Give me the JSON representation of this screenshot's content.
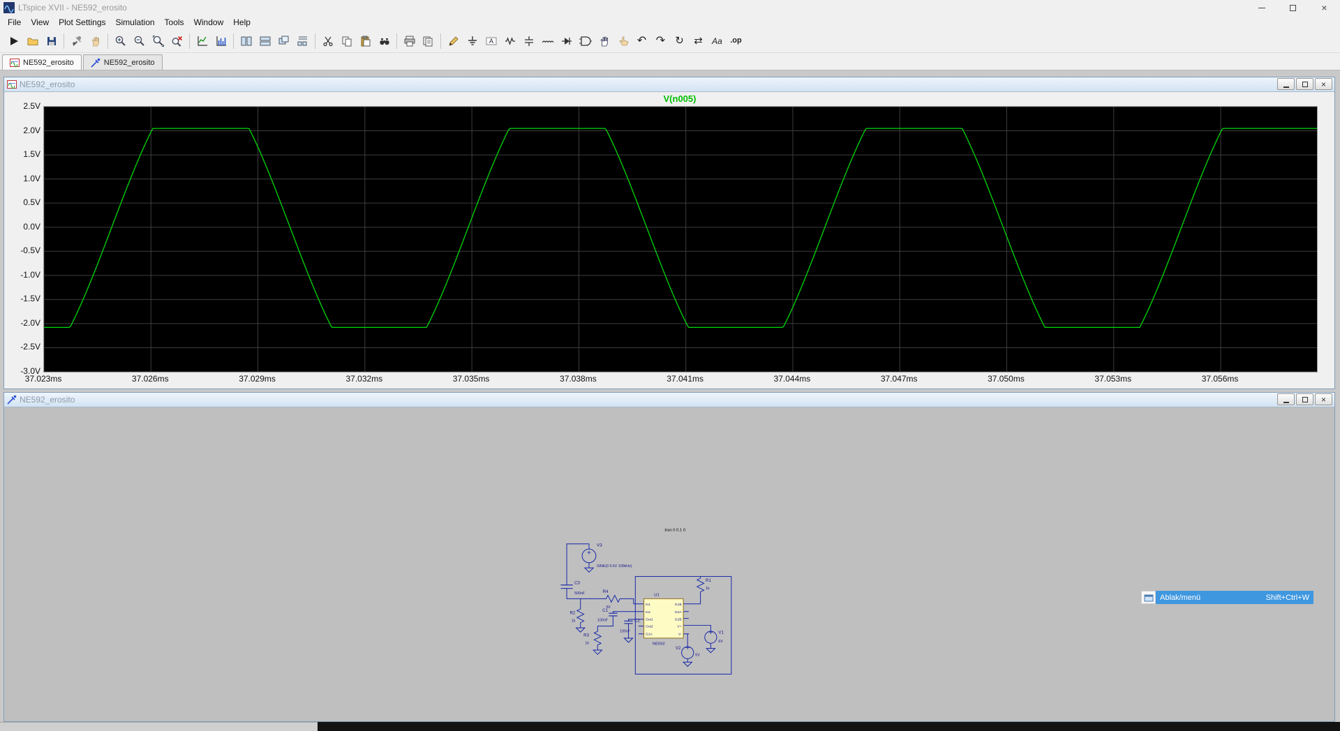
{
  "titlebar": {
    "title": "LTspice XVII - NE592_erosito"
  },
  "menu": {
    "items": [
      "File",
      "View",
      "Plot Settings",
      "Simulation",
      "Tools",
      "Window",
      "Help"
    ]
  },
  "toolbar": {
    "groups": [
      [
        "run",
        "open",
        "save"
      ],
      [
        "control-panel",
        "pan"
      ],
      [
        "zoom-in",
        "zoom-out",
        "zoom-full",
        "zoom-back"
      ],
      [
        "autorange",
        "plot-settings"
      ],
      [
        "tile-vertical",
        "tile-horizontal",
        "cascade-windows",
        "arrange-icons"
      ],
      [
        "cut",
        "copy",
        "paste",
        "find"
      ],
      [
        "print",
        "print-all"
      ],
      [
        "draw-wire",
        "ground",
        "net-label",
        "resistor",
        "capacitor",
        "inductor",
        "diode",
        "component",
        "move",
        "drag",
        "undo",
        "redo",
        "rotate",
        "mirror",
        "text",
        "spice-directive"
      ]
    ]
  },
  "tabs": [
    {
      "label": "NE592_erosito",
      "kind": "plot",
      "active": true
    },
    {
      "label": "NE592_erosito",
      "kind": "schematic",
      "active": false
    }
  ],
  "plot_window": {
    "title": "NE592_erosito",
    "legend": "V(n005)"
  },
  "chart_data": {
    "type": "line",
    "title": "V(n005)",
    "series": [
      {
        "name": "V(n005)",
        "color": "#00d80a"
      }
    ],
    "x_axis": {
      "unit": "ms",
      "min": 37.023,
      "max": 37.0587,
      "ticks": [
        "37.023ms",
        "37.026ms",
        "37.029ms",
        "37.032ms",
        "37.035ms",
        "37.038ms",
        "37.041ms",
        "37.044ms",
        "37.047ms",
        "37.050ms",
        "37.053ms",
        "37.056ms"
      ],
      "tick_values_ms": [
        37.023,
        37.026,
        37.029,
        37.032,
        37.035,
        37.038,
        37.041,
        37.044,
        37.047,
        37.05,
        37.053,
        37.056
      ]
    },
    "y_axis": {
      "unit": "V",
      "min": -3.0,
      "max": 2.5,
      "ticks": [
        "2.5V",
        "2.0V",
        "1.5V",
        "1.0V",
        "0.5V",
        "0.0V",
        "-0.5V",
        "-1.0V",
        "-1.5V",
        "-2.0V",
        "-2.5V",
        "-3.0V"
      ],
      "tick_values": [
        2.5,
        2.0,
        1.5,
        1.0,
        0.5,
        0.0,
        -0.5,
        -1.0,
        -1.5,
        -2.0,
        -2.5,
        -3.0
      ]
    },
    "grid": true,
    "background": "#000000",
    "waveform": {
      "kind": "clipped-sine",
      "frequency_kHz": 100,
      "period_ms": 0.01,
      "unclipped_amplitude_V": 3.1,
      "clip_high_V": 2.05,
      "clip_low_V": -2.08,
      "rising_zero_crossing_ms": 37.0249
    }
  },
  "schematic_window": {
    "title": "NE592_erosito",
    "directive": ".tran 0 0.1 0",
    "ic": {
      "designator": "U1",
      "part": "NE592",
      "pins_left": [
        "In1",
        "In2",
        "Out1",
        "Out2",
        "G1A"
      ],
      "pins_right": [
        "G1B",
        "G2A",
        "G2B",
        "V+",
        "V-"
      ]
    },
    "parts": {
      "v3": {
        "name": "V3",
        "value": "SINE(0 0.5V 100kHz)"
      },
      "c3": {
        "name": "C3",
        "value": "500nF"
      },
      "r4": {
        "name": "R4",
        "value": "50"
      },
      "r1": {
        "name": "R1",
        "value": "1k"
      },
      "r2": {
        "name": "R2",
        "value": "1k"
      },
      "r3": {
        "name": "R3",
        "value": "1k"
      },
      "c1": {
        "name": "C1",
        "value": "100nF"
      },
      "c2": {
        "name": "C2",
        "value": "100nF"
      },
      "v1": {
        "name": "V1",
        "value": "6V"
      },
      "v2": {
        "name": "V2",
        "value": "6V"
      }
    }
  },
  "context_menu": {
    "label": "Ablak/menü",
    "shortcut": "Shift+Ctrl+W"
  }
}
